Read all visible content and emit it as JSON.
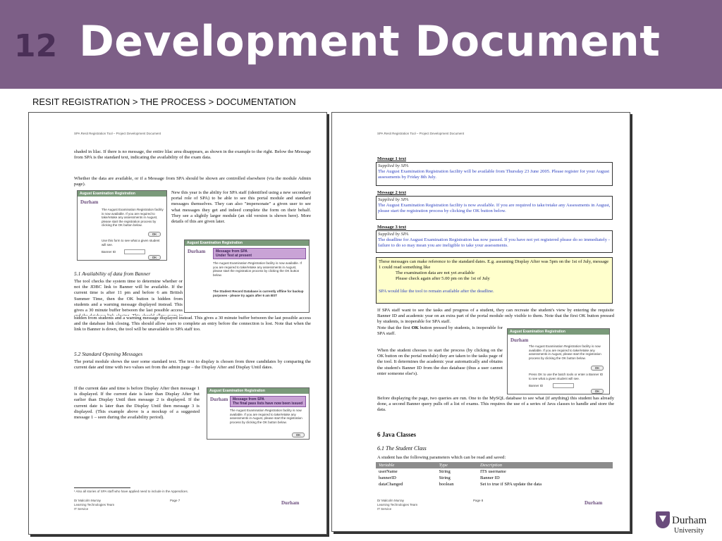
{
  "slide": {
    "number": "12",
    "title": "Development Document"
  },
  "breadcrumb": "RESIT REGISTRATION > THE PROCESS > DOCUMENTATION",
  "page1": {
    "header": "SPA Resit Registration Tool – Project Development Document",
    "intro": "shaded in lilac. If there is no message, the entire lilac area disappears, as shown in the example to the right. Below the Message from SPA is the standard text, indicating the availability of the exam data.",
    "para2": "Whether the data are available, or if a Message from SPA should be shown are controlled elsewhere (via the module Admin page).",
    "para3": "New this year is the ability for SPA staff (identified using a new secondary portal role of SPA) to be able to see this portal module and standard messages themselves. They can also \"impersonate\" a given user to see what messages they get and indeed complete the form on their behalf. They see a slightly larger module (an old version is shown here). More details of this are given later.",
    "section_51": "5.1   Availability of data from Banner",
    "para51": "The tool checks the system time to determine whether or not the JDBC link to Banner will be available. If the current time is after 11 pm and before 6 am British Summer Time, then the OK button is hidden from students and a warning message displayed instead. This gives a 30 minute buffer between the last possible access and the database link closing. This should allow users to complete an entry before the connection is lost. Note that when the link to Banner is down, the tool will be unavailable to SPA staff too.",
    "section_52": "5.2   Standard Opening Messages",
    "para52": "The portal module shows the user some standard text. The text to display is chosen from three candidates by comparing the current date and time with two values set from the admin page – the Display After and Display Until dates.",
    "para53": "If the current date and time is before Display After then message 1 is displayed. If the current date is later than Display After but earlier than Display Until then message 2 is displayed. If the current date is later than the Display Until then message 3 is displayed. (This example above is a mockup of a suggested message 1 – seen during the availability period).",
    "footnote": "¹ Also all stories of SPA staff who have applied need to include in the Appendices.",
    "footer_author": "Dr Malcolm Murray",
    "footer_team": "Learning Technologies Team",
    "footer_service": "IT Service",
    "page_no": "Page 7",
    "logo": "Durham",
    "widget1_title": "August Examination Registration",
    "widget1_text": "The August Examination Registration facility is now available. If you are required to take/retake any assessments in August, please start the registration process by clicking the OK button below.",
    "widget1_spa": "Use this form to see what a given student will see.",
    "widget1_banner": "Banner ID",
    "widget2_title": "August Examination Registration",
    "widget2_spa_title": "Message from SPA",
    "widget2_spa_sub": "Under Test at present",
    "widget2_text": "The August Examination Registration facility is now available. If you are required to take/retake any assessments in August, please start the registration process by clicking the OK button below.",
    "widget2_bold": "The Student Record Database is currently offline for backup purposes - please try again after 6 am BST",
    "widget3_title": "August Examination Registration",
    "widget3_spa_title": "Message from SPA",
    "widget3_spa_sub": "The final pass lists have now been issued",
    "widget3_text": "The August Examination Registration facility is now available. If you are required to take/retake any assessments in August, please start the registration process by clicking the OK button below.",
    "ok": "OK"
  },
  "page2": {
    "header": "SPA Resit Registration Tool – Project Development Document",
    "m1_title": "Message 1 text",
    "m1_by": "Supplied by SPA",
    "m1_text": "The August Examination Registration facility will be available from Thursday 23 June 2005. Please register for your August assessments by Friday 8th July.",
    "m2_title": "Message 2 text",
    "m2_by": "Supplied by SPA",
    "m2_text": "The August Examination Registration facility is now available. If you are required to take/retake any Assessments in August, please start the registration process by clicking the OK button below.",
    "m3_title": "Message 3 text",
    "m3_by": "Supplied by SPA",
    "m3_text": "The deadline for August Examination Registration has now passed. If you have not yet registered please do so immediately - failure to do so may mean you are ineligible to take your assessments.",
    "note_text": "These messages can make reference to the standard dates. E.g. assuming Display After was 5pm on the 1st of July, message 1 could read something like",
    "note_q1": "The examination data are not yet available",
    "note_q2": "Please check again after 5.00 pm on the 1st of July",
    "note_spa": "SPA would like the tool to remain available after the deadline.",
    "para_impersonate": "If SPA staff want to see the tasks and progress of a student, they can recreate the student's view by entering the requisite Banner ID and academic year on an extra part of the portal module only visible to them. Note that the first OK button pressed by students, is inoperable for SPA staff.",
    "para_start": "When the student chooses to start the process (by clicking on the OK button on the portal module) they are taken to the tasks page of the tool. It determines the academic year automatically and obtains the student's Banner ID from the duo database (thus a user cannot enter someone else's).",
    "para_before": "Before displaying the page, two queries are run. One to the MySQL database to see what (if anything) this student has already done, a second Banner query pulls off a list of exams. This requires the use of a series of Java classes to handle and store the data.",
    "section_6": "6    Java Classes",
    "section_61": "6.1   The Student Class",
    "class_intro": "A student has the following parameters which can be read and saved:",
    "table_headers": [
      "Variable",
      "Type",
      "Description"
    ],
    "table_rows": [
      [
        "userName",
        "String",
        "ITS username"
      ],
      [
        "bannerID",
        "String",
        "Banner ID"
      ],
      [
        "dataChanged",
        "boolean",
        "Set to true if SPA update the data"
      ]
    ],
    "widget_title": "August Examination Registration",
    "widget_text": "The August Examination Registration facility is now available. If you are required to take/retake any assessments in August, please start the registration process by clicking the OK button below.",
    "widget_spa": "Press OK to use the batch tools or enter a Banner ID to see what a given student will see.",
    "widget_banner": "Banner ID",
    "footer_author": "Dr Malcolm Murray",
    "footer_team": "Learning Technologies Team",
    "footer_service": "IT Service",
    "page_no": "Page 8",
    "logo": "Durham",
    "ok": "OK"
  },
  "logo": {
    "name": "Durham",
    "sub": "University"
  }
}
